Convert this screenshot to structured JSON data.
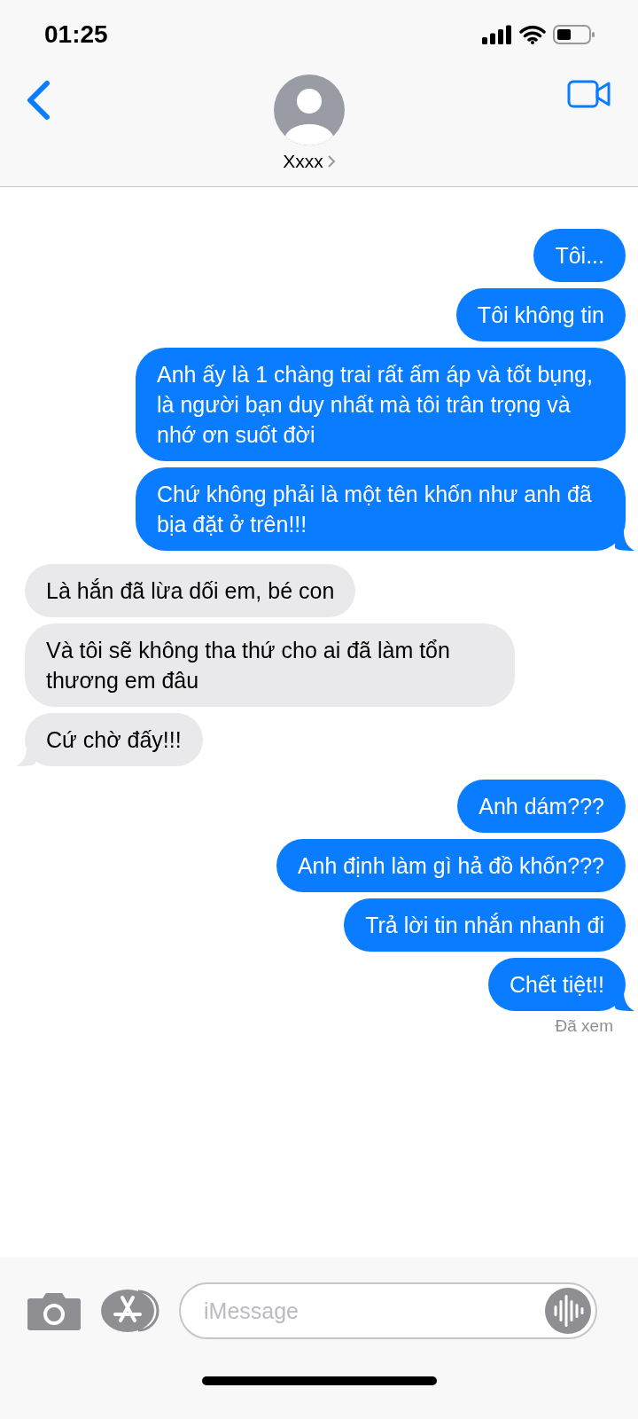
{
  "status_bar": {
    "time": "01:25"
  },
  "header": {
    "contact_name": "Xxxx"
  },
  "messages": [
    {
      "kind": "sent",
      "text": "Tôi...",
      "tail": false
    },
    {
      "kind": "sent",
      "text": "Tôi không tin",
      "tail": false
    },
    {
      "kind": "sent",
      "text": "Anh ấy là 1 chàng trai rất ấm áp và tốt bụng, là người bạn duy nhất mà tôi trân trọng và nhớ ơn suốt đời",
      "tail": false
    },
    {
      "kind": "sent",
      "text": "Chứ không phải là một tên khốn như anh đã bịa đặt ở trên!!!",
      "tail": true
    },
    {
      "kind": "received",
      "text": "Là hắn đã lừa dối em, bé con",
      "tail": false
    },
    {
      "kind": "received",
      "text": "Và tôi sẽ không tha thứ cho ai đã làm tổn thương em đâu",
      "tail": false
    },
    {
      "kind": "received",
      "text": "Cứ chờ đấy!!!",
      "tail": true
    },
    {
      "kind": "sent",
      "text": "Anh dám???",
      "tail": false
    },
    {
      "kind": "sent",
      "text": "Anh định làm gì hả đồ khốn???",
      "tail": false
    },
    {
      "kind": "sent",
      "text": "Trả lời tin nhắn nhanh đi",
      "tail": false
    },
    {
      "kind": "sent",
      "text": "Chết tiệt!!",
      "tail": true
    }
  ],
  "read_receipt": "Đã xem",
  "composer": {
    "placeholder": "iMessage"
  }
}
